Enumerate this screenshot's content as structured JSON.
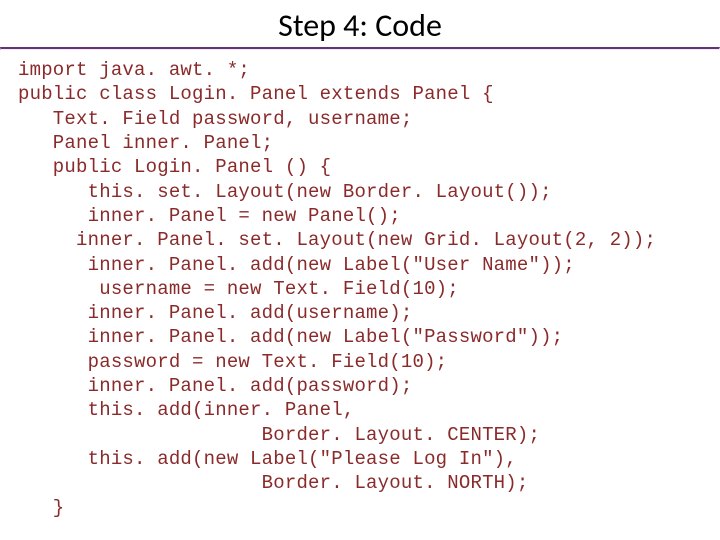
{
  "title": "Step 4: Code",
  "code": {
    "l1": "import java. awt. *;",
    "l2": "public class Login. Panel extends Panel {",
    "l3": "   Text. Field password, username;",
    "l4": "   Panel inner. Panel;",
    "l5": "   public Login. Panel () {",
    "l6": "      this. set. Layout(new Border. Layout());",
    "l7": "      inner. Panel = new Panel();",
    "l8": "     inner. Panel. set. Layout(new Grid. Layout(2, 2));",
    "l9": "      inner. Panel. add(new Label(\"User Name\"));",
    "l10": "       username = new Text. Field(10);",
    "l11": "      inner. Panel. add(username);",
    "l12": "      inner. Panel. add(new Label(\"Password\"));",
    "l13": "      password = new Text. Field(10);",
    "l14": "      inner. Panel. add(password);",
    "l15": "      this. add(inner. Panel,",
    "l16": "                     Border. Layout. CENTER);",
    "l17": "      this. add(new Label(\"Please Log In\"),",
    "l18": "                     Border. Layout. NORTH);",
    "l19": "   }"
  }
}
